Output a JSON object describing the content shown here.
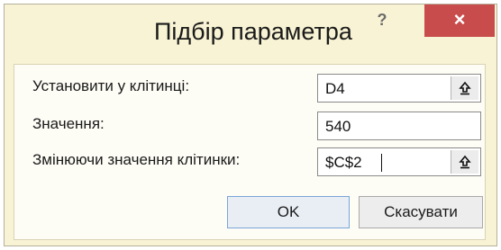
{
  "dialog": {
    "title": "Підбір параметра",
    "help_label": "?",
    "close_label": "×"
  },
  "form": {
    "set_cell_label": "Установити у клітинці:",
    "set_cell_value": "D4",
    "to_value_label": "Значення:",
    "to_value_value": "540",
    "changing_cell_label": "Змінюючи значення клітинки:",
    "changing_cell_value": "$C$2"
  },
  "buttons": {
    "ok_label": "OK",
    "cancel_label": "Скасувати"
  },
  "colors": {
    "window_bg": "#f8f3d4",
    "close_button_bg": "#c94c4c",
    "ok_focus_border": "#7aa5d6"
  },
  "icons": {
    "collapse": "collapse-dialog-icon",
    "close": "close-icon",
    "help": "help-icon"
  }
}
